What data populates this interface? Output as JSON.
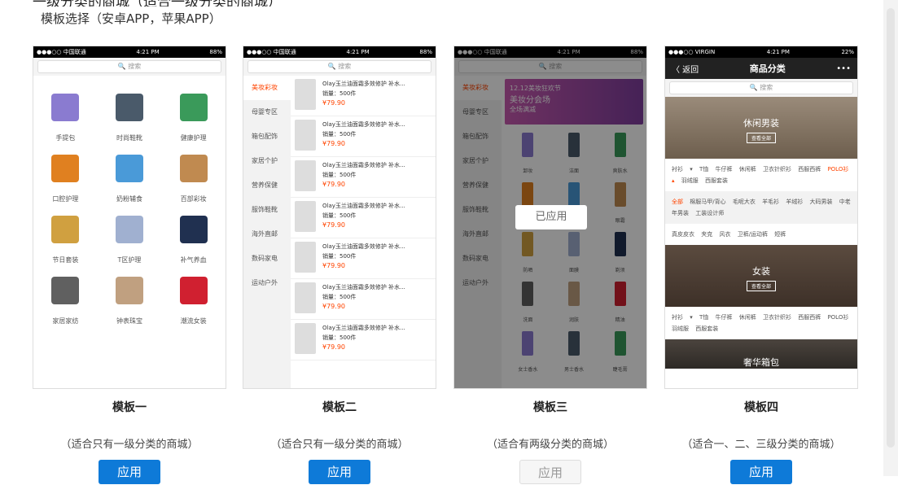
{
  "header": {
    "top_cut_text": "一级分类的商城（适合一级分类的商城）",
    "title": "模板选择（安卓APP，苹果APP）"
  },
  "colors": {
    "accent": "#0e7ad8",
    "price": "#ff4400"
  },
  "t1": {
    "status": {
      "carrier": "●●●○○ 中国联通 ",
      "time": "4:21 PM",
      "battery": "88%"
    },
    "search": "🔍 搜索",
    "items": [
      "手提包",
      "时尚鞋靴",
      "健康护理",
      "口腔护理",
      "奶粉辅食",
      "百部彩妆",
      "节日套装",
      "T区护理",
      "补气养血",
      "家居家纺",
      "钟表珠宝",
      "潮流女装"
    ],
    "name": "模板一",
    "desc": "（适合只有一级分类的商城）",
    "btn": "应用"
  },
  "t2": {
    "status": {
      "carrier": "●●●○○ 中国联通 ",
      "time": "4:21 PM",
      "battery": "88%"
    },
    "search": "🔍 搜索",
    "cats": [
      "美妆彩妆",
      "母婴专区",
      "箱包配饰",
      "家居个护",
      "营养保健",
      "服饰鞋靴",
      "海外直邮",
      "数码家电",
      "运动户外"
    ],
    "product": {
      "title": "Olay玉兰油面霜多效修护 补水...",
      "sales": "销量：500件",
      "price": "¥79.90"
    },
    "name": "模板二",
    "desc": "（适合只有一级分类的商城）",
    "btn": "应用"
  },
  "t3": {
    "status": {
      "carrier": "●●●○○ 中国联通 ",
      "time": "4:21 PM",
      "battery": "88%"
    },
    "search": "🔍 搜索",
    "cats": [
      "美妆彩妆",
      "母婴专区",
      "箱包配饰",
      "家居个护",
      "营养保健",
      "服饰鞋靴",
      "海外直邮",
      "数码家电",
      "运动户外"
    ],
    "banner": {
      "line1": "12.12美妆狂欢节",
      "line2": "美妆分会场",
      "line3": "全场满减"
    },
    "items": [
      "卸妆",
      "洁面",
      "爽肤水",
      "",
      "",
      "眼霜",
      "防晒",
      "面膜",
      "剃须",
      "洗面",
      "润肤",
      "精油",
      "女士香水",
      "男士香水",
      "睫毛膏"
    ],
    "applied": "已应用",
    "name": "模板三",
    "desc": "（适合有两级分类的商城）",
    "btn": "应用"
  },
  "t4": {
    "status": {
      "carrier": "●●●○○ VIRGIN ",
      "time": "4:21 PM",
      "battery": "22%"
    },
    "nav": {
      "back": "〈 返回",
      "title": "商品分类",
      "more": "•••"
    },
    "search": "🔍 搜索",
    "hero1": "休闲男装",
    "hero2": "女装",
    "hero3": "奢华箱包",
    "see": "查看全部",
    "tags1": [
      "衬衫 ▾",
      "T恤",
      "牛仔裤",
      "休闲裤",
      "卫衣针织衫",
      "西服西裤",
      "POLO衫 ▴",
      "羽绒服",
      "西服套装"
    ],
    "tags2": [
      "全部",
      "棉服马甲/背心",
      "毛呢大衣",
      "羊毛衫",
      "羊绒衫",
      "大码男装",
      "中老年男装",
      "工装设计师"
    ],
    "tags3": [
      "真皮皮衣",
      "夹克",
      "风衣",
      "卫裤/运动裤",
      "短裤"
    ],
    "tags4": [
      "衬衫 ▾",
      "T恤",
      "牛仔裤",
      "休闲裤",
      "卫衣针织衫",
      "西服西裤",
      "POLO衫",
      "羽绒服",
      "西服套装"
    ],
    "name": "模板四",
    "desc": "（适合一、二、三级分类的商城）",
    "btn": "应用"
  }
}
